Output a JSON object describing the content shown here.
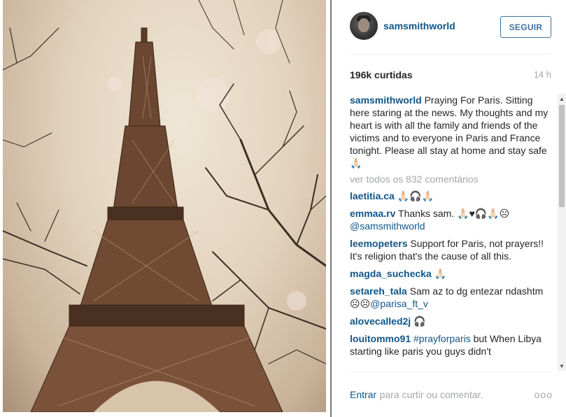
{
  "post": {
    "username": "samsmithworld",
    "follow_label": "SEGUIR",
    "likes": "196k curtidas",
    "time_ago": "14 h",
    "view_all": "ver todos os 832 comentários"
  },
  "caption": {
    "user": "samsmithworld",
    "text": "Praying For Paris. Sitting here staring at the news. My thoughts and my heart is with all the family and friends of the victims and to everyone in Paris and France tonight. Please all stay at home and stay safe 🙏🏻"
  },
  "comments": [
    {
      "user": "laetitia.ca",
      "text": "🙏🏻🎧🙏🏻"
    },
    {
      "user": "emmaa.rv",
      "text": "Thanks sam. 🙏🏻♥🎧🙏🏻☹",
      "mention": "@samsmithworld"
    },
    {
      "user": "leemopeters",
      "text": "Support for Paris, not prayers!! It's religion that's the cause of all this."
    },
    {
      "user": "magda_suchecka",
      "text": "🙏🏻"
    },
    {
      "user": "setareh_tala",
      "text": "Sam az to dg entezar ndashtm ☹☹",
      "mention": "@parisa_ft_v"
    },
    {
      "user": "alovecalled2j",
      "text": "🎧"
    },
    {
      "user": "louitommo91",
      "hashtag": "#prayforparis",
      "text": "but When Libya starting like paris you guys didn't"
    }
  ],
  "footer": {
    "signin": "Entrar",
    "prompt": "para curtir ou comentar.",
    "more": "ooo"
  },
  "icons": {
    "more": "ellipsis-icon",
    "scroll_up": "triangle-up-icon",
    "scroll_down": "triangle-down-icon"
  },
  "colors": {
    "link": "#125688",
    "follow": "#3f729b",
    "muted": "#a5a7aa"
  }
}
